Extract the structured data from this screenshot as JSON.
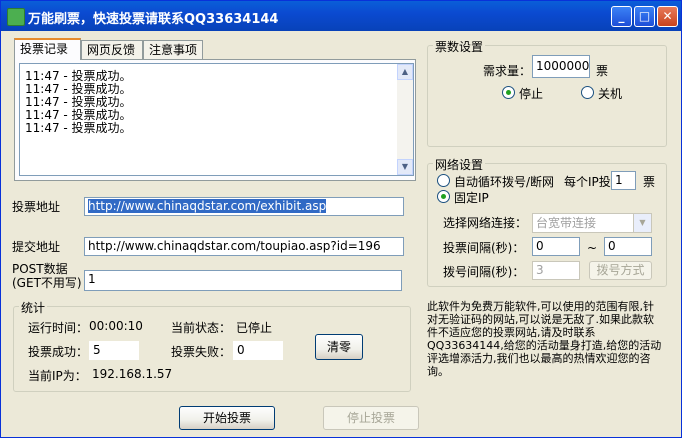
{
  "window": {
    "title": "万能刷票，快速投票请联系QQ33634144"
  },
  "tabs": [
    "投票记录",
    "网页反馈",
    "注意事项"
  ],
  "log": {
    "lines": [
      "11:47 - 投票成功。",
      "11:47 - 投票成功。",
      "11:47 - 投票成功。",
      "11:47 - 投票成功。",
      "11:47 - 投票成功。"
    ]
  },
  "form": {
    "vote_url_label": "投票地址",
    "vote_url_value": "http://www.chinaqdstar.com/exhibit.asp",
    "submit_url_label": "提交地址",
    "submit_url_value": "http://www.chinaqdstar.com/toupiao.asp?id=196",
    "post_label_1": "POST数据",
    "post_label_2": "(GET不用写)",
    "post_value": "1"
  },
  "stats": {
    "title": "统计",
    "runtime_label": "运行时间：",
    "runtime_value": "00:00:10",
    "status_label": "当前状态：",
    "status_value": "已停止",
    "success_label": "投票成功：",
    "success_value": "5",
    "fail_label": "投票失败：",
    "fail_value": "0",
    "clear_button": "清零",
    "ip_label": "当前IP为：",
    "ip_value": "192.168.1.57"
  },
  "votes_settings": {
    "title": "票数设置",
    "demand_label": "需求量：",
    "demand_value": "1000000",
    "unit": "票",
    "stop_label": "停止",
    "shutdown_label": "关机"
  },
  "network": {
    "title": "网络设置",
    "auto_dial_label": "自动循环拨号/断网",
    "per_ip_label": "每个IP投",
    "per_ip_value": "1",
    "per_ip_unit": "票",
    "fixed_ip_label": "固定IP",
    "connection_label": "选择网络连接：",
    "connection_value": "台宽带连接",
    "interval_label": "投票间隔(秒)：",
    "interval_from": "0",
    "interval_sep": "~",
    "interval_to": "0",
    "dial_interval_label": "拨号间隔(秒)：",
    "dial_interval_value": "3",
    "dial_mode_button": "拨号方式"
  },
  "info_text": "此软件为免费万能软件,可以使用的范围有限,针对无验证码的网站,可以说是无敌了.如果此款软件不适应您的投票网站,请及时联系QQ33634144,给您的活动量身打造,给您的活动评选增添活力,我们也以最高的热情欢迎您的咨询。",
  "actions": {
    "start_button": "开始投票",
    "stop_button": "停止投票"
  }
}
